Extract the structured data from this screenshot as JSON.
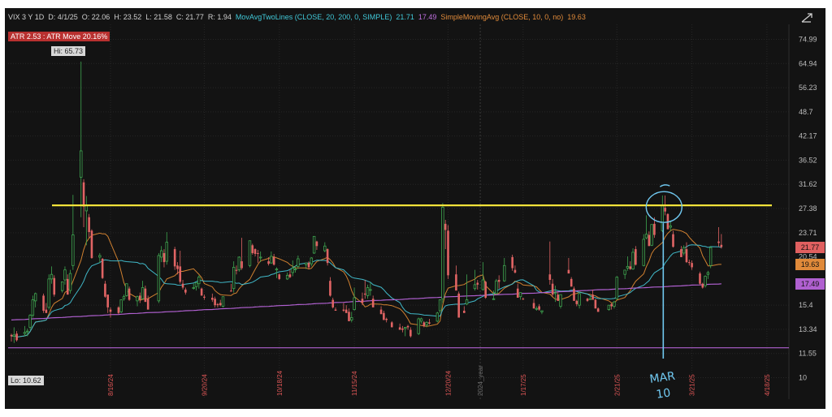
{
  "header": {
    "symbol": "VIX 3 Y 1D",
    "date": "D: 4/1/25",
    "open": "O: 22.06",
    "high": "H: 23.52",
    "low": "L: 21.58",
    "close": "C: 21.77",
    "range": "R: 1.94",
    "ma2_label": "MovAvgTwoLines (CLOSE, 20, 200, 0, SIMPLE)",
    "ma2_fast_value": "21.71",
    "ma2_slow_value": "17.49",
    "sma_label": "SimpleMovingAvg (CLOSE, 10, 0, no)",
    "sma_value": "19.63"
  },
  "atr_badge": "ATR 2.53 : ATR Move 20.16%",
  "hi_label": "Hi: 65.73",
  "lo_label": "Lo: 10.62",
  "price_tags": [
    {
      "text": "21.77",
      "value": 21.77,
      "color": "#e06060"
    },
    {
      "text": "19.63",
      "value": 19.63,
      "color": "#e08a3a"
    },
    {
      "text": "17.49",
      "value": 17.49,
      "color": "#b060d0"
    }
  ],
  "colors": {
    "up": "#3fa650",
    "down": "#e06464",
    "ma20": "#40b8c8",
    "ma200": "#b060d0",
    "sma10": "#d08030",
    "resistance": "#f2e33a",
    "annotation": "#70c8f0",
    "support": "#b060d0"
  },
  "chart_data": {
    "type": "candlestick",
    "y_scale": "log",
    "ylim": [
      8.8,
      82
    ],
    "y_ticks": [
      "74.99",
      "64.94",
      "56.23",
      "48.7",
      "42.17",
      "36.52",
      "31.62",
      "27.38",
      "23.71",
      "20.54",
      "15.4",
      "13.34",
      "11.55",
      "10"
    ],
    "x_ticks": [
      "8/16/24",
      "9/20/24",
      "10/18/24",
      "11/15/24",
      "12/20/24",
      "1/17/25",
      "2/21/25",
      "3/21/25",
      "4/18/25"
    ],
    "year_marker": "2024_year",
    "x_range": [
      "2024-07-10",
      "2025-04-25"
    ],
    "resistance_level": 27.9,
    "support_level": 11.95,
    "annotation_text": [
      "MAR",
      "10"
    ],
    "annotation_date": "2025-03-10",
    "annotation_price": 29,
    "candles": [
      [
        "2024-07-10",
        12.9,
        13.0,
        12.4,
        12.8
      ],
      [
        "2024-07-11",
        12.8,
        13.5,
        12.3,
        12.9
      ],
      [
        "2024-07-12",
        13.0,
        13.2,
        12.4,
        12.5
      ],
      [
        "2024-07-15",
        13.0,
        13.6,
        12.8,
        13.1
      ],
      [
        "2024-07-16",
        13.2,
        13.4,
        12.8,
        13.2
      ],
      [
        "2024-07-17",
        13.5,
        14.6,
        13.3,
        14.5
      ],
      [
        "2024-07-18",
        14.5,
        16.3,
        14.3,
        15.9
      ],
      [
        "2024-07-19",
        15.8,
        16.6,
        15.2,
        16.5
      ],
      [
        "2024-07-22",
        16.3,
        16.5,
        14.7,
        14.9
      ],
      [
        "2024-07-23",
        15.0,
        15.6,
        14.7,
        14.7
      ],
      [
        "2024-07-24",
        15.2,
        18.5,
        15.0,
        18.0
      ],
      [
        "2024-07-25",
        18.0,
        19.4,
        17.5,
        18.5
      ],
      [
        "2024-07-26",
        18.1,
        18.4,
        16.2,
        16.4
      ],
      [
        "2024-07-29",
        16.8,
        17.6,
        16.6,
        17.7
      ],
      [
        "2024-07-30",
        17.9,
        19.4,
        17.4,
        19.0
      ],
      [
        "2024-07-31",
        18.0,
        18.5,
        16.4,
        16.4
      ],
      [
        "2024-08-01",
        16.8,
        19.0,
        16.5,
        18.6
      ],
      [
        "2024-08-02",
        19.5,
        29.7,
        19.0,
        23.4
      ],
      [
        "2024-08-05",
        33.0,
        65.7,
        26.0,
        38.6
      ],
      [
        "2024-08-06",
        32.0,
        32.6,
        24.5,
        27.7
      ],
      [
        "2024-08-07",
        27.0,
        29.5,
        22.0,
        27.9
      ],
      [
        "2024-08-08",
        26.0,
        26.5,
        23.0,
        23.8
      ],
      [
        "2024-08-09",
        24.0,
        24.2,
        20.3,
        20.4
      ],
      [
        "2024-08-12",
        20.5,
        21.0,
        19.8,
        20.7
      ],
      [
        "2024-08-13",
        20.3,
        20.4,
        18.0,
        18.1
      ],
      [
        "2024-08-14",
        17.5,
        17.8,
        16.1,
        16.2
      ],
      [
        "2024-08-15",
        16.4,
        16.4,
        14.7,
        15.2
      ],
      [
        "2024-08-16",
        15.0,
        15.2,
        14.3,
        14.8
      ],
      [
        "2024-08-19",
        15.2,
        15.3,
        14.6,
        14.7
      ],
      [
        "2024-08-20",
        14.8,
        15.9,
        14.7,
        15.9
      ],
      [
        "2024-08-21",
        16.0,
        16.4,
        15.8,
        16.2
      ],
      [
        "2024-08-22",
        16.3,
        17.5,
        16.2,
        17.5
      ],
      [
        "2024-08-23",
        17.0,
        17.2,
        15.8,
        15.9
      ],
      [
        "2024-08-26",
        15.8,
        16.3,
        15.3,
        16.2
      ],
      [
        "2024-08-27",
        16.3,
        16.6,
        15.6,
        15.9
      ],
      [
        "2024-08-28",
        16.0,
        17.8,
        15.9,
        17.1
      ],
      [
        "2024-08-29",
        17.0,
        17.3,
        15.8,
        15.7
      ],
      [
        "2024-08-30",
        16.0,
        16.3,
        15.1,
        15.0
      ],
      [
        "2024-09-03",
        15.8,
        21.0,
        15.6,
        20.7
      ],
      [
        "2024-09-04",
        20.5,
        21.9,
        19.9,
        21.3
      ],
      [
        "2024-09-05",
        21.0,
        21.5,
        19.3,
        19.9
      ],
      [
        "2024-09-06",
        20.0,
        23.8,
        19.6,
        22.4
      ],
      [
        "2024-09-09",
        21.5,
        21.8,
        19.0,
        19.4
      ],
      [
        "2024-09-10",
        19.5,
        19.9,
        18.5,
        19.1
      ],
      [
        "2024-09-11",
        19.4,
        21.3,
        17.5,
        17.7
      ],
      [
        "2024-09-12",
        17.5,
        17.9,
        16.9,
        17.1
      ],
      [
        "2024-09-13",
        16.9,
        17.1,
        16.4,
        16.6
      ],
      [
        "2024-09-16",
        17.1,
        17.5,
        16.9,
        17.1
      ],
      [
        "2024-09-17",
        17.2,
        17.4,
        16.8,
        17.6
      ],
      [
        "2024-09-18",
        17.5,
        18.4,
        17.0,
        18.2
      ],
      [
        "2024-09-19",
        17.0,
        17.1,
        16.3,
        16.3
      ],
      [
        "2024-09-20",
        16.2,
        16.4,
        15.9,
        16.1
      ],
      [
        "2024-09-23",
        16.1,
        16.5,
        15.7,
        15.9
      ],
      [
        "2024-09-24",
        16.0,
        16.2,
        15.2,
        15.4
      ],
      [
        "2024-09-25",
        15.5,
        15.6,
        15.2,
        15.4
      ],
      [
        "2024-09-26",
        15.6,
        15.9,
        15.3,
        15.4
      ],
      [
        "2024-09-27",
        15.3,
        16.2,
        15.2,
        16.2
      ],
      [
        "2024-09-30",
        16.8,
        17.5,
        16.7,
        16.7
      ],
      [
        "2024-10-01",
        17.0,
        20.0,
        16.6,
        19.3
      ],
      [
        "2024-10-02",
        19.0,
        19.5,
        18.5,
        18.9
      ],
      [
        "2024-10-03",
        19.0,
        20.6,
        18.8,
        20.5
      ],
      [
        "2024-10-04",
        20.0,
        23.0,
        19.0,
        19.2
      ],
      [
        "2024-10-07",
        19.5,
        22.6,
        19.3,
        22.6
      ],
      [
        "2024-10-08",
        22.0,
        22.2,
        20.8,
        21.0
      ],
      [
        "2024-10-09",
        21.5,
        21.6,
        20.6,
        20.9
      ],
      [
        "2024-10-10",
        21.0,
        21.4,
        19.8,
        20.9
      ],
      [
        "2024-10-11",
        20.5,
        21.2,
        19.9,
        20.5
      ],
      [
        "2024-10-14",
        20.0,
        20.5,
        19.5,
        19.7
      ],
      [
        "2024-10-15",
        19.8,
        21.2,
        19.7,
        20.6
      ],
      [
        "2024-10-16",
        20.5,
        20.9,
        19.5,
        19.6
      ],
      [
        "2024-10-17",
        19.0,
        19.3,
        18.1,
        19.1
      ],
      [
        "2024-10-18",
        18.5,
        18.6,
        17.9,
        18.0
      ],
      [
        "2024-10-21",
        18.0,
        18.7,
        17.9,
        18.4
      ],
      [
        "2024-10-22",
        18.5,
        19.0,
        18.1,
        18.2
      ],
      [
        "2024-10-23",
        18.7,
        20.1,
        18.3,
        19.2
      ],
      [
        "2024-10-24",
        19.1,
        19.5,
        18.7,
        19.1
      ],
      [
        "2024-10-25",
        19.4,
        20.7,
        19.1,
        20.3
      ],
      [
        "2024-10-28",
        19.6,
        19.8,
        19.1,
        19.8
      ],
      [
        "2024-10-29",
        19.8,
        20.0,
        19.1,
        19.3
      ],
      [
        "2024-10-30",
        19.7,
        20.5,
        19.4,
        20.4
      ],
      [
        "2024-10-31",
        21.0,
        23.2,
        20.9,
        23.2
      ],
      [
        "2024-11-01",
        22.5,
        22.6,
        21.4,
        21.9
      ],
      [
        "2024-11-04",
        21.3,
        22.4,
        21.1,
        21.9
      ],
      [
        "2024-11-05",
        21.5,
        21.6,
        19.5,
        19.8
      ],
      [
        "2024-11-06",
        17.8,
        18.2,
        16.2,
        16.3
      ],
      [
        "2024-11-07",
        15.9,
        16.1,
        15.1,
        15.2
      ],
      [
        "2024-11-08",
        15.0,
        15.2,
        14.9,
        14.9
      ],
      [
        "2024-11-11",
        15.0,
        15.6,
        14.8,
        14.9
      ],
      [
        "2024-11-12",
        15.0,
        15.4,
        14.7,
        14.7
      ],
      [
        "2024-11-13",
        14.8,
        15.1,
        14.0,
        14.0
      ],
      [
        "2024-11-14",
        14.1,
        14.8,
        13.9,
        14.3
      ],
      [
        "2024-11-15",
        15.0,
        17.1,
        14.9,
        16.1
      ],
      [
        "2024-11-18",
        16.0,
        16.6,
        15.4,
        15.6
      ],
      [
        "2024-11-19",
        16.5,
        17.9,
        16.0,
        16.4
      ],
      [
        "2024-11-20",
        16.3,
        17.4,
        16.0,
        17.1
      ],
      [
        "2024-11-21",
        16.9,
        17.6,
        16.3,
        16.9
      ],
      [
        "2024-11-22",
        16.0,
        16.3,
        15.2,
        15.2
      ],
      [
        "2024-11-25",
        15.0,
        15.3,
        14.6,
        14.6
      ],
      [
        "2024-11-26",
        14.7,
        14.9,
        14.1,
        14.1
      ],
      [
        "2024-11-27",
        14.2,
        14.3,
        13.9,
        14.1
      ],
      [
        "2024-11-29",
        13.9,
        14.0,
        13.5,
        13.5
      ],
      [
        "2024-12-02",
        13.5,
        13.8,
        13.3,
        13.3
      ],
      [
        "2024-12-03",
        13.4,
        13.6,
        13.1,
        13.3
      ],
      [
        "2024-12-04",
        13.4,
        13.5,
        12.8,
        13.5
      ],
      [
        "2024-12-05",
        13.6,
        13.7,
        13.3,
        13.5
      ],
      [
        "2024-12-06",
        13.3,
        13.5,
        12.7,
        12.8
      ],
      [
        "2024-12-09",
        13.0,
        14.3,
        12.9,
        14.2
      ],
      [
        "2024-12-10",
        14.0,
        14.3,
        13.8,
        14.2
      ],
      [
        "2024-12-11",
        13.9,
        14.0,
        13.5,
        13.6
      ],
      [
        "2024-12-12",
        13.7,
        14.0,
        13.5,
        13.9
      ],
      [
        "2024-12-13",
        13.9,
        14.2,
        13.7,
        13.8
      ],
      [
        "2024-12-16",
        14.0,
        14.8,
        13.9,
        14.7
      ],
      [
        "2024-12-17",
        14.9,
        15.9,
        14.7,
        15.9
      ],
      [
        "2024-12-18",
        16.0,
        28.3,
        15.6,
        27.6
      ],
      [
        "2024-12-19",
        25.0,
        25.6,
        21.5,
        24.1
      ],
      [
        "2024-12-20",
        24.0,
        24.8,
        18.0,
        18.4
      ],
      [
        "2024-12-23",
        18.5,
        19.5,
        16.9,
        16.8
      ],
      [
        "2024-12-24",
        16.5,
        16.7,
        14.3,
        14.3
      ],
      [
        "2024-12-26",
        14.9,
        15.3,
        14.7,
        14.7
      ],
      [
        "2024-12-27",
        15.5,
        18.5,
        15.4,
        15.9
      ],
      [
        "2024-12-30",
        17.0,
        19.0,
        16.8,
        17.4
      ],
      [
        "2024-12-31",
        17.6,
        17.9,
        16.9,
        17.4
      ],
      [
        "2025-01-02",
        16.9,
        19.9,
        16.8,
        17.9
      ],
      [
        "2025-01-03",
        17.7,
        17.8,
        16.0,
        16.1
      ],
      [
        "2025-01-06",
        16.0,
        16.8,
        15.9,
        16.0
      ],
      [
        "2025-01-07",
        16.5,
        18.0,
        16.4,
        17.8
      ],
      [
        "2025-01-08",
        17.9,
        18.4,
        17.0,
        17.7
      ],
      [
        "2025-01-10",
        17.8,
        20.4,
        17.7,
        19.5
      ],
      [
        "2025-01-13",
        20.5,
        20.8,
        18.9,
        19.2
      ],
      [
        "2025-01-14",
        19.0,
        19.5,
        18.6,
        18.7
      ],
      [
        "2025-01-15",
        17.0,
        17.5,
        16.1,
        16.1
      ],
      [
        "2025-01-16",
        16.2,
        16.6,
        15.9,
        16.6
      ],
      [
        "2025-01-17",
        16.0,
        16.1,
        15.9,
        15.97
      ],
      [
        "2025-01-21",
        15.6,
        16.0,
        15.1,
        15.1
      ],
      [
        "2025-01-22",
        15.1,
        15.3,
        14.9,
        15.1
      ],
      [
        "2025-01-23",
        15.3,
        15.5,
        14.9,
        15.0
      ],
      [
        "2025-01-24",
        14.8,
        14.9,
        14.6,
        14.9
      ],
      [
        "2025-01-27",
        18.5,
        22.5,
        17.4,
        17.9
      ],
      [
        "2025-01-28",
        17.5,
        18.0,
        16.2,
        16.4
      ],
      [
        "2025-01-29",
        16.5,
        17.3,
        15.7,
        16.6
      ],
      [
        "2025-01-30",
        16.4,
        16.7,
        15.8,
        15.8
      ],
      [
        "2025-01-31",
        15.3,
        16.4,
        15.1,
        16.4
      ],
      [
        "2025-02-03",
        19.0,
        20.4,
        18.6,
        18.6
      ],
      [
        "2025-02-04",
        18.0,
        18.2,
        17.2,
        17.2
      ],
      [
        "2025-02-05",
        17.0,
        17.2,
        15.9,
        15.8
      ],
      [
        "2025-02-06",
        15.8,
        15.9,
        15.3,
        15.5
      ],
      [
        "2025-02-07",
        15.4,
        16.6,
        15.1,
        16.5
      ],
      [
        "2025-02-10",
        16.0,
        16.1,
        15.7,
        15.8
      ],
      [
        "2025-02-11",
        16.0,
        16.3,
        15.9,
        16.0
      ],
      [
        "2025-02-12",
        16.4,
        16.9,
        15.9,
        15.9
      ],
      [
        "2025-02-13",
        15.9,
        16.0,
        15.1,
        15.1
      ],
      [
        "2025-02-14",
        15.1,
        15.2,
        14.8,
        14.8
      ],
      [
        "2025-02-18",
        15.0,
        15.3,
        14.9,
        15.4
      ],
      [
        "2025-02-19",
        15.5,
        15.6,
        15.0,
        15.3
      ],
      [
        "2025-02-20",
        15.3,
        15.8,
        15.1,
        15.7
      ],
      [
        "2025-02-21",
        16.0,
        18.3,
        15.9,
        18.2
      ],
      [
        "2025-02-24",
        18.5,
        18.9,
        18.0,
        18.98
      ],
      [
        "2025-02-25",
        19.2,
        20.6,
        18.9,
        19.4
      ],
      [
        "2025-02-26",
        19.4,
        20.0,
        19.0,
        19.1
      ],
      [
        "2025-02-27",
        19.1,
        21.6,
        19.0,
        21.1
      ],
      [
        "2025-02-28",
        21.5,
        21.9,
        19.5,
        19.6
      ],
      [
        "2025-03-03",
        19.5,
        23.5,
        19.4,
        22.8
      ],
      [
        "2025-03-04",
        23.0,
        26.3,
        22.8,
        23.5
      ],
      [
        "2025-03-05",
        23.4,
        23.9,
        21.9,
        21.9
      ],
      [
        "2025-03-06",
        22.0,
        24.9,
        21.9,
        24.9
      ],
      [
        "2025-03-07",
        25.0,
        26.0,
        23.0,
        23.4
      ],
      [
        "2025-03-10",
        24.0,
        29.6,
        23.8,
        27.9
      ],
      [
        "2025-03-11",
        27.5,
        29.6,
        26.3,
        26.9
      ],
      [
        "2025-03-12",
        26.5,
        26.6,
        24.2,
        24.2
      ],
      [
        "2025-03-13",
        24.5,
        25.5,
        23.9,
        24.7
      ],
      [
        "2025-03-14",
        23.5,
        24.0,
        21.7,
        21.8
      ],
      [
        "2025-03-17",
        21.5,
        21.9,
        20.5,
        20.5
      ],
      [
        "2025-03-18",
        21.0,
        22.0,
        20.7,
        21.7
      ],
      [
        "2025-03-19",
        21.5,
        22.4,
        19.8,
        19.9
      ],
      [
        "2025-03-20",
        19.9,
        20.2,
        19.5,
        19.8
      ],
      [
        "2025-03-21",
        19.8,
        20.1,
        19.0,
        19.3
      ],
      [
        "2025-03-24",
        18.6,
        18.8,
        17.4,
        17.5
      ],
      [
        "2025-03-25",
        17.5,
        17.6,
        17.0,
        17.1
      ],
      [
        "2025-03-26",
        17.3,
        18.4,
        17.1,
        18.3
      ],
      [
        "2025-03-27",
        18.5,
        18.9,
        18.0,
        18.7
      ],
      [
        "2025-03-28",
        19.5,
        21.9,
        19.2,
        21.7
      ],
      [
        "2025-03-31",
        22.5,
        24.5,
        21.8,
        22.3
      ],
      [
        "2025-04-01",
        22.06,
        23.52,
        21.58,
        21.77
      ]
    ]
  }
}
